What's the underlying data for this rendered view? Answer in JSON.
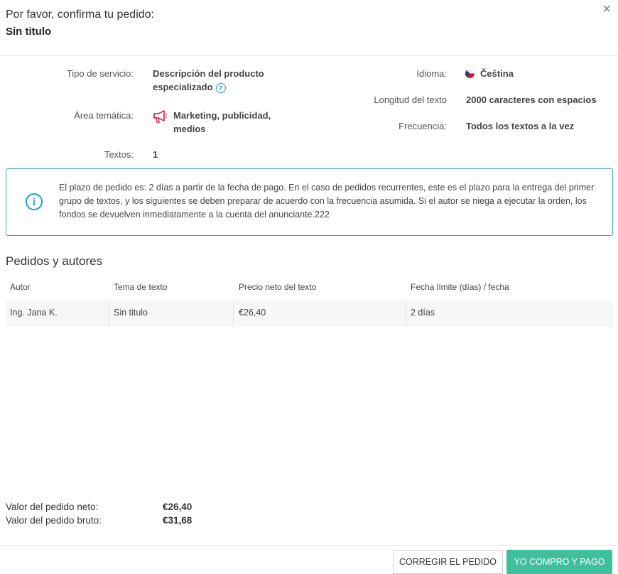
{
  "header": {
    "prompt": "Por favor, confirma tu pedido:",
    "order_title": "Sin titulo",
    "close_glyph": "×"
  },
  "details": {
    "service_type_label": "Tipo de servicio:",
    "service_type_value_line1": "Descripción del producto",
    "service_type_value_line2": "especializado",
    "topic_label": "Área temática:",
    "topic_value_line1": "Marketing, publicidad,",
    "topic_value_line2": "medios",
    "texts_label": "Textos:",
    "texts_value": "1",
    "language_label": "Idioma:",
    "language_value": "Čeština",
    "length_label": "Longitud del texto",
    "length_value": "2000 caracteres con espacios",
    "frequency_label": "Frecuencia:",
    "frequency_value": "Todos los textos a la vez"
  },
  "info": {
    "text": "El plazo de pedido es: 2  días a partir de la fecha de pago. En el caso de pedidos recurrentes, este es el plazo para la entrega del primer grupo de textos, y los siguientes se deben preparar de acuerdo con la frecuencia asumida. Si el autor se niega a ejecutar la orden, los fondos se devuelven inmediatamente a la cuenta del anunciante.222"
  },
  "orders": {
    "section_title": "Pedidos y autores",
    "columns": [
      "Autor",
      "Tema de texto",
      "Precio neto del texto",
      "Fecha límite (días) / fecha"
    ],
    "rows": [
      [
        "Ing. Jana K.",
        "Sin titulo",
        "€26,40",
        "2 días"
      ]
    ]
  },
  "totals": {
    "net_label": "Valor del pedido neto:",
    "net_value": "€26,40",
    "gross_label": "Valor del pedido bruto:",
    "gross_value": "€31,68"
  },
  "buttons": {
    "correct": "CORREGIR EL PEDIDO",
    "buy": "YO COMPRO Y PAGO"
  },
  "colors": {
    "accent": "#3fbf9c",
    "info": "#1a9ed6",
    "topic_icon": "#d9304f"
  },
  "icons": {
    "close": "close-icon",
    "help": "help-icon",
    "megaphone": "megaphone-icon",
    "flag": "czech-flag-icon",
    "info": "info-icon"
  }
}
